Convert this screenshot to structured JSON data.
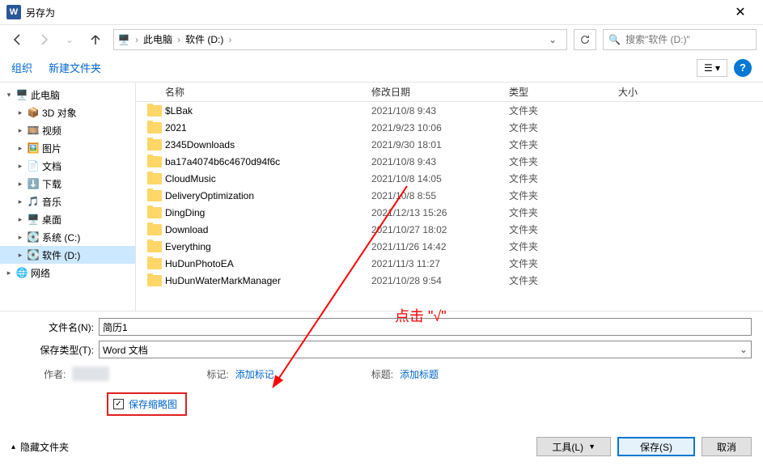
{
  "title": "另存为",
  "breadcrumb": {
    "root": "此电脑",
    "current": "软件 (D:)"
  },
  "search_placeholder": "搜索\"软件 (D:)\"",
  "toolbar": {
    "organize": "组织",
    "new_folder": "新建文件夹"
  },
  "sidebar": {
    "this_pc": "此电脑",
    "items": [
      {
        "label": "3D 对象",
        "icon": "cube"
      },
      {
        "label": "视频",
        "icon": "video"
      },
      {
        "label": "图片",
        "icon": "picture"
      },
      {
        "label": "文档",
        "icon": "document"
      },
      {
        "label": "下载",
        "icon": "download"
      },
      {
        "label": "音乐",
        "icon": "music"
      },
      {
        "label": "桌面",
        "icon": "desktop"
      },
      {
        "label": "系统 (C:)",
        "icon": "drive"
      },
      {
        "label": "软件 (D:)",
        "icon": "drive",
        "selected": true
      }
    ],
    "network": "网络"
  },
  "columns": {
    "name": "名称",
    "date": "修改日期",
    "type": "类型",
    "size": "大小"
  },
  "files": [
    {
      "name": "$LBak",
      "date": "2021/10/8 9:43",
      "type": "文件夹"
    },
    {
      "name": "2021",
      "date": "2021/9/23 10:06",
      "type": "文件夹"
    },
    {
      "name": "2345Downloads",
      "date": "2021/9/30 18:01",
      "type": "文件夹"
    },
    {
      "name": "ba17a4074b6c4670d94f6c",
      "date": "2021/10/8 9:43",
      "type": "文件夹"
    },
    {
      "name": "CloudMusic",
      "date": "2021/10/8 14:05",
      "type": "文件夹"
    },
    {
      "name": "DeliveryOptimization",
      "date": "2021/10/8 8:55",
      "type": "文件夹"
    },
    {
      "name": "DingDing",
      "date": "2021/12/13 15:26",
      "type": "文件夹"
    },
    {
      "name": "Download",
      "date": "2021/10/27 18:02",
      "type": "文件夹"
    },
    {
      "name": "Everything",
      "date": "2021/11/26 14:42",
      "type": "文件夹"
    },
    {
      "name": "HuDunPhotoEA",
      "date": "2021/11/3 11:27",
      "type": "文件夹"
    },
    {
      "name": "HuDunWaterMarkManager",
      "date": "2021/10/28 9:54",
      "type": "文件夹"
    }
  ],
  "filename_label": "文件名(N):",
  "filename_value": "简历1",
  "filetype_label": "保存类型(T):",
  "filetype_value": "Word 文档",
  "meta": {
    "author_label": "作者:",
    "tags_label": "标记:",
    "tags_value": "添加标记",
    "title_label": "标题:",
    "title_value": "添加标题"
  },
  "thumbnail_checkbox": "保存缩略图",
  "footer": {
    "hide_folders": "隐藏文件夹",
    "tools": "工具(L)",
    "save": "保存(S)",
    "cancel": "取消"
  },
  "annotation": "点击 \"√\""
}
